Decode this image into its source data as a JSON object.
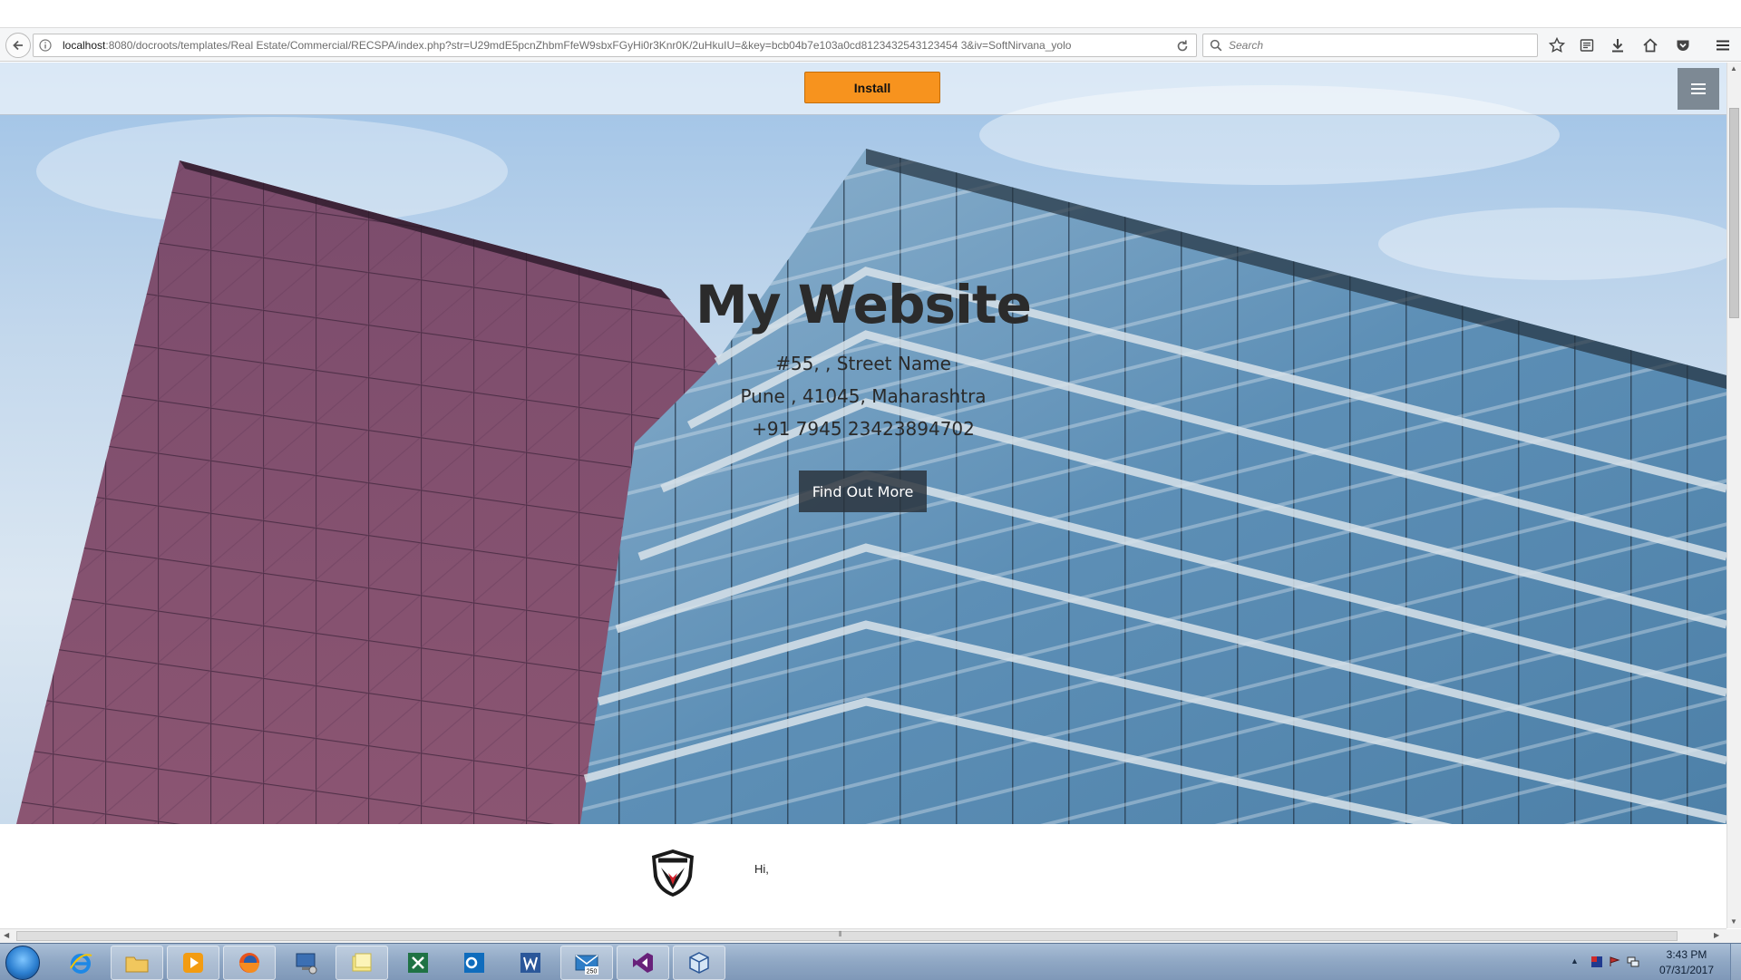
{
  "browser": {
    "url_host": "localhost",
    "url_rest": ":8080/docroots/templates/Real Estate/Commercial/RECSPA/index.php?str=U29mdE5pcnZhbmFfeW9sbxFGyHi0r3Knr0K/2uHkuIU=&key=bcb04b7e103a0cd8123432543123454 3&iv=SoftNirvana_yolo",
    "search_placeholder": "Search"
  },
  "page": {
    "install_label": "Install",
    "hero_title": "My Website",
    "address_line1": "#55, , Street Name",
    "address_line2": "Pune , 41045, Maharashtra",
    "address_line3": "+91 7945 23423894702",
    "find_out_more": "Find Out More",
    "greeting": "Hi,"
  },
  "taskbar": {
    "apps": [
      "Internet Explorer",
      "Windows Explorer",
      "Windows Media Player",
      "Firefox",
      "Computer",
      "Sticky Notes",
      "Excel",
      "Outlook",
      "Word",
      "Mail",
      "Visual Studio",
      "VirtualBox"
    ],
    "mail_badge": "250",
    "time": "3:43 PM",
    "date": "07/31/2017"
  }
}
